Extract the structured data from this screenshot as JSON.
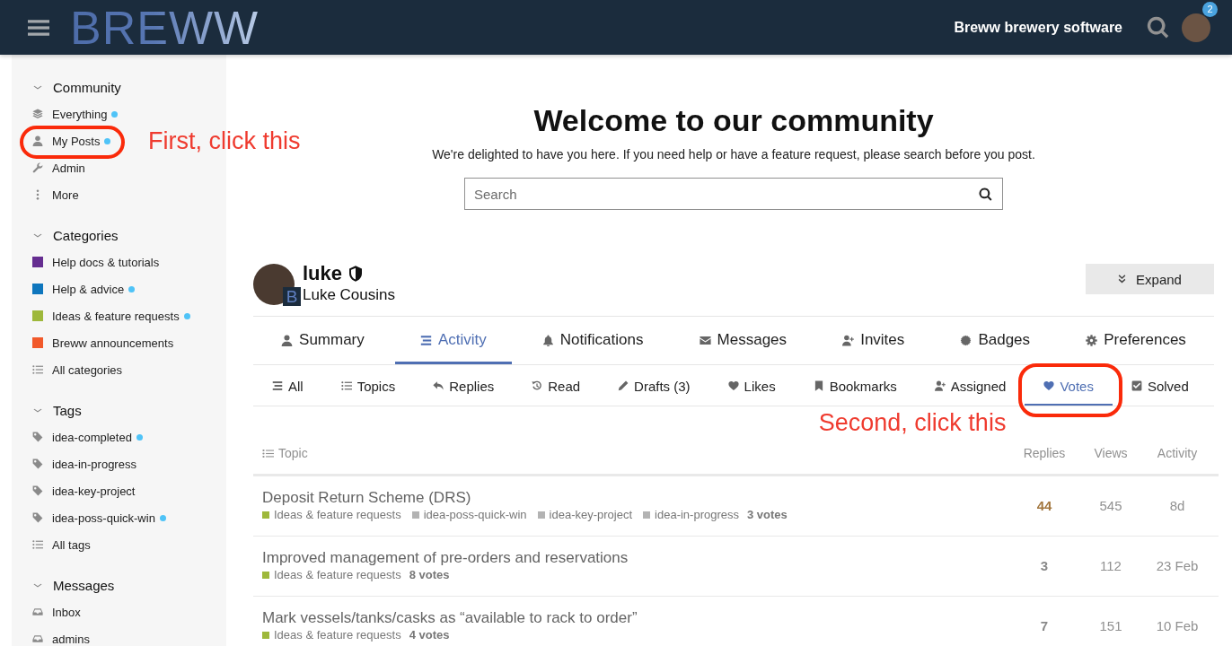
{
  "header": {
    "logo": "BREWW",
    "site_title": "Breww brewery software",
    "notification_count": "2"
  },
  "sidebar": {
    "sections": [
      {
        "title": "Community",
        "expanded": true,
        "items": [
          {
            "kind": "link",
            "label": "Everything",
            "unread": true
          },
          {
            "kind": "link",
            "label": "My Posts",
            "unread": true,
            "callout": "First, click this"
          },
          {
            "kind": "link",
            "label": "Admin",
            "unread": false
          },
          {
            "kind": "link",
            "label": "More",
            "unread": false
          }
        ]
      },
      {
        "title": "Categories",
        "expanded": true,
        "items": [
          {
            "kind": "category",
            "label": "Help docs & tutorials",
            "color": "#652d90",
            "unread": false
          },
          {
            "kind": "category",
            "label": "Help & advice",
            "color": "#0e76bd",
            "unread": true
          },
          {
            "kind": "category",
            "label": "Ideas & feature requests",
            "color": "#9eb83b",
            "unread": true
          },
          {
            "kind": "category",
            "label": "Breww announcements",
            "color": "#f1592a",
            "unread": false
          },
          {
            "kind": "all",
            "label": "All categories",
            "unread": false
          }
        ]
      },
      {
        "title": "Tags",
        "expanded": true,
        "items": [
          {
            "kind": "tag",
            "label": "idea-completed",
            "unread": true
          },
          {
            "kind": "tag",
            "label": "idea-in-progress",
            "unread": false
          },
          {
            "kind": "tag",
            "label": "idea-key-project",
            "unread": false
          },
          {
            "kind": "tag",
            "label": "idea-poss-quick-win",
            "unread": true
          },
          {
            "kind": "all",
            "label": "All tags",
            "unread": false
          }
        ]
      },
      {
        "title": "Messages",
        "expanded": true,
        "items": [
          {
            "kind": "inbox",
            "label": "Inbox",
            "unread": false
          },
          {
            "kind": "inbox",
            "label": "admins",
            "unread": false
          }
        ]
      }
    ]
  },
  "welcome": {
    "title": "Welcome to our community",
    "subtitle": "We're delighted to have you here. If you need help or have a feature request, please search before you post.",
    "search": {
      "placeholder": "Search"
    }
  },
  "profile": {
    "username": "luke",
    "moderator": true,
    "full_name": "Luke Cousins",
    "flair": "B",
    "expand_button": "Expand"
  },
  "profile_tabs": [
    {
      "label": "Summary",
      "selected": false
    },
    {
      "label": "Activity",
      "selected": true
    },
    {
      "label": "Notifications",
      "selected": false
    },
    {
      "label": "Messages",
      "selected": false
    },
    {
      "label": "Invites",
      "selected": false
    },
    {
      "label": "Badges",
      "selected": false
    },
    {
      "label": "Preferences",
      "selected": false
    }
  ],
  "activity_tabs": [
    {
      "label": "All",
      "selected": false
    },
    {
      "label": "Topics",
      "selected": false
    },
    {
      "label": "Replies",
      "selected": false
    },
    {
      "label": "Read",
      "selected": false
    },
    {
      "label": "Drafts (3)",
      "selected": false
    },
    {
      "label": "Likes",
      "selected": false
    },
    {
      "label": "Bookmarks",
      "selected": false
    },
    {
      "label": "Assigned",
      "selected": false
    },
    {
      "label": "Votes",
      "selected": true,
      "callout": "Second, click this"
    },
    {
      "label": "Solved",
      "selected": false
    }
  ],
  "topic_list": {
    "columns": [
      "Topic",
      "Replies",
      "Views",
      "Activity"
    ],
    "rows": [
      {
        "title": "Deposit Return Scheme (DRS)",
        "category": {
          "name": "Ideas & feature requests",
          "color": "#9eb83b"
        },
        "tags": [
          "idea-poss-quick-win",
          "idea-key-project",
          "idea-in-progress"
        ],
        "votes": "3 votes",
        "replies": "44",
        "replies_hot": true,
        "views": "545",
        "activity": "8d"
      },
      {
        "title": "Improved management of pre-orders and reservations",
        "category": {
          "name": "Ideas & feature requests",
          "color": "#9eb83b"
        },
        "tags": [],
        "votes": "8 votes",
        "replies": "3",
        "replies_hot": false,
        "views": "112",
        "activity": "23 Feb"
      },
      {
        "title": "Mark vessels/tanks/casks as “available to rack to order”",
        "category": {
          "name": "Ideas & feature requests",
          "color": "#9eb83b"
        },
        "tags": [],
        "votes": "4 votes",
        "replies": "7",
        "replies_hot": false,
        "views": "151",
        "activity": "10 Feb"
      }
    ]
  }
}
